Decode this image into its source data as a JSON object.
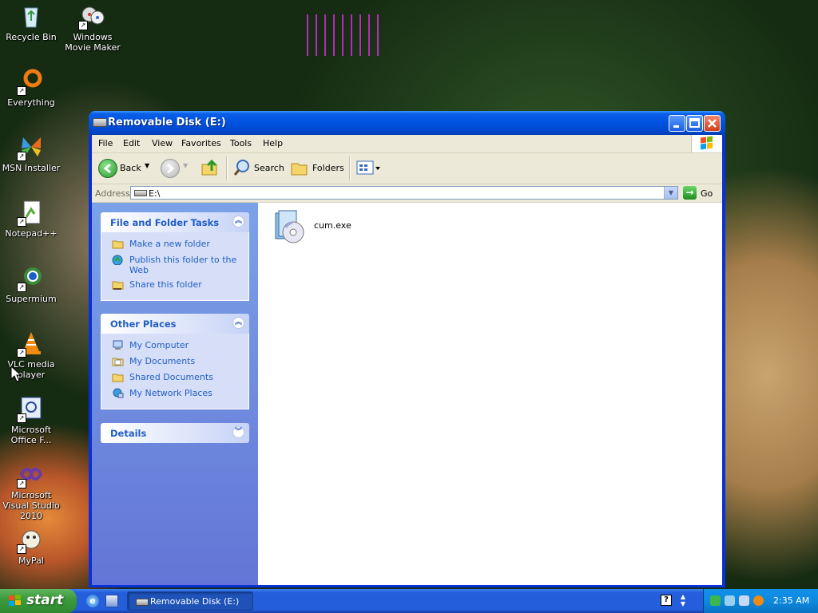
{
  "desktop": {
    "icons": [
      {
        "label": "Recycle Bin"
      },
      {
        "label": "Windows Movie Maker"
      },
      {
        "label": "Everything"
      },
      {
        "label": "MSN Installer"
      },
      {
        "label": "Notepad++"
      },
      {
        "label": "Supermium"
      },
      {
        "label": "VLC media player"
      },
      {
        "label": "Microsoft Office F..."
      },
      {
        "label": "Microsoft Visual Studio 2010"
      },
      {
        "label": "MyPal"
      }
    ]
  },
  "window": {
    "title": "Removable Disk (E:)",
    "minimize_icon": "minimize-icon",
    "maximize_icon": "maximize-icon",
    "close_icon": "close-icon",
    "menu": [
      "File",
      "Edit",
      "View",
      "Favorites",
      "Tools",
      "Help"
    ],
    "toolbar": {
      "back_label": "Back",
      "search_label": "Search",
      "folders_label": "Folders"
    },
    "address": {
      "label": "Address",
      "value": "E:\\",
      "go_label": "Go"
    },
    "tasks_panel": {
      "file_folder_tasks": {
        "title": "File and Folder Tasks",
        "items": [
          {
            "label": "Make a new folder",
            "icon": "new-folder-icon"
          },
          {
            "label": "Publish this folder to the Web",
            "icon": "publish-web-icon"
          },
          {
            "label": "Share this folder",
            "icon": "share-folder-icon"
          }
        ]
      },
      "other_places": {
        "title": "Other Places",
        "items": [
          {
            "label": "My Computer",
            "icon": "my-computer-icon"
          },
          {
            "label": "My Documents",
            "icon": "my-documents-icon"
          },
          {
            "label": "Shared Documents",
            "icon": "shared-documents-icon"
          },
          {
            "label": "My Network Places",
            "icon": "network-places-icon"
          }
        ]
      },
      "details": {
        "title": "Details"
      }
    },
    "files": [
      {
        "name": "cum.exe",
        "icon": "installer-icon"
      }
    ]
  },
  "taskbar": {
    "start_label": "start",
    "task_button_label": "Removable Disk (E:)",
    "clock": "2:35 AM"
  },
  "colors": {
    "titlebar": "#0052e0",
    "taskpane_link": "#215dc6",
    "taskbar": "#245edb",
    "start_button": "#3c9a3c"
  }
}
